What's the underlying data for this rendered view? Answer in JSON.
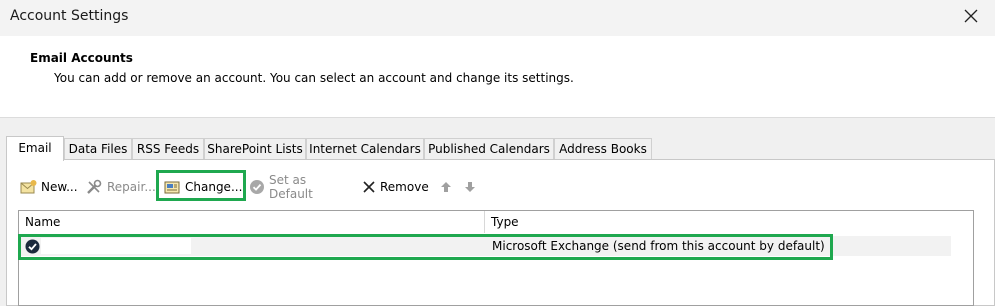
{
  "window": {
    "title": "Account Settings"
  },
  "header": {
    "title": "Email Accounts",
    "description": "You can add or remove an account. You can select an account and change its settings."
  },
  "tabs": [
    {
      "label": "Email",
      "active": true
    },
    {
      "label": "Data Files"
    },
    {
      "label": "RSS Feeds"
    },
    {
      "label": "SharePoint Lists"
    },
    {
      "label": "Internet Calendars"
    },
    {
      "label": "Published Calendars"
    },
    {
      "label": "Address Books"
    }
  ],
  "toolbar": {
    "new_label": "New...",
    "repair_label": "Repair...",
    "change_label": "Change...",
    "set_default_label": "Set as Default",
    "remove_label": "Remove"
  },
  "list": {
    "columns": [
      "Name",
      "Type"
    ],
    "rows": [
      {
        "name": "",
        "type": "Microsoft Exchange (send from this account by default)",
        "default": true
      }
    ]
  },
  "colors": {
    "highlight": "#1fa84f"
  }
}
